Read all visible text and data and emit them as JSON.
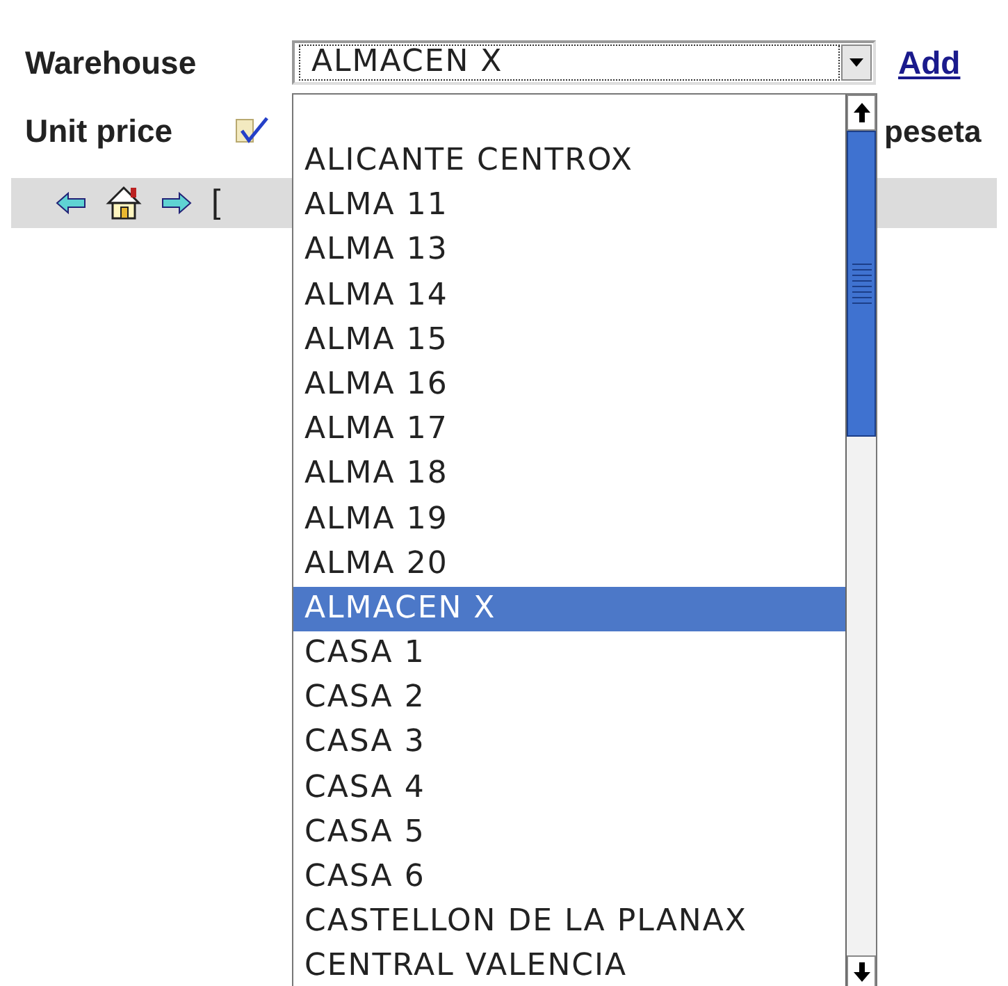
{
  "form": {
    "warehouse_label": "Warehouse",
    "warehouse_value": "ALMACEN X",
    "add_link": "Add",
    "unit_price_label": "Unit price",
    "currency_text": "peseta"
  },
  "nav_bar": {
    "bracket_text": "["
  },
  "dropdown": {
    "options": [
      {
        "label": "ALICANTE CENTROX",
        "selected": false
      },
      {
        "label": "ALMA 11",
        "selected": false
      },
      {
        "label": "ALMA 13",
        "selected": false
      },
      {
        "label": "ALMA 14",
        "selected": false
      },
      {
        "label": "ALMA 15",
        "selected": false
      },
      {
        "label": "ALMA 16",
        "selected": false
      },
      {
        "label": "ALMA 17",
        "selected": false
      },
      {
        "label": "ALMA 18",
        "selected": false
      },
      {
        "label": "ALMA 19",
        "selected": false
      },
      {
        "label": "ALMA 20",
        "selected": false
      },
      {
        "label": "ALMACEN X",
        "selected": true
      },
      {
        "label": "CASA 1",
        "selected": false
      },
      {
        "label": "CASA 2",
        "selected": false
      },
      {
        "label": "CASA 3",
        "selected": false
      },
      {
        "label": "CASA 4",
        "selected": false
      },
      {
        "label": "CASA 5",
        "selected": false
      },
      {
        "label": "CASA 6",
        "selected": false
      },
      {
        "label": "CASTELLON DE LA PLANAX",
        "selected": false
      },
      {
        "label": "CENTRAL VALENCIA",
        "selected": false
      }
    ]
  }
}
